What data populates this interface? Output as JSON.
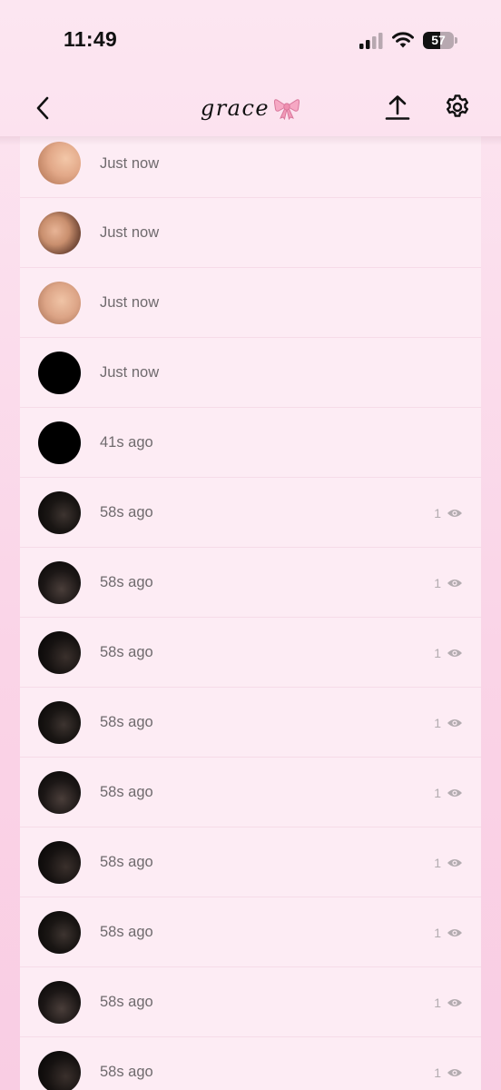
{
  "status_bar": {
    "time": "11:49",
    "battery_percent": "57",
    "battery_level": 0.57,
    "icons": [
      "cellular-signal-icon",
      "wifi-icon",
      "battery-icon"
    ]
  },
  "nav": {
    "title": "grace",
    "title_emoji_icon": "ribbon-bow-icon",
    "left_icon": "chevron-left-icon",
    "right_icons": [
      "upload-icon",
      "gear-icon"
    ]
  },
  "colors": {
    "background": "#fce6f1",
    "list_background": "#fdecf4",
    "timestamp_text": "#6f6a6d",
    "view_count_text": "#b3acb0",
    "bow_pink": "#f29ab8"
  },
  "snaps": [
    {
      "time": "Just now",
      "thumb": "skin-tone-photo",
      "views": ""
    },
    {
      "time": "Just now",
      "thumb": "skin-tone-photo",
      "views": ""
    },
    {
      "time": "Just now",
      "thumb": "skin-tone-photo",
      "views": ""
    },
    {
      "time": "Just now",
      "thumb": "black-photo",
      "views": ""
    },
    {
      "time": "41s ago",
      "thumb": "black-photo",
      "views": ""
    },
    {
      "time": "58s ago",
      "thumb": "dark-photo",
      "views": "1"
    },
    {
      "time": "58s ago",
      "thumb": "dark-photo",
      "views": "1"
    },
    {
      "time": "58s ago",
      "thumb": "dark-photo",
      "views": "1"
    },
    {
      "time": "58s ago",
      "thumb": "dark-photo",
      "views": "1"
    },
    {
      "time": "58s ago",
      "thumb": "dark-photo",
      "views": "1"
    },
    {
      "time": "58s ago",
      "thumb": "dark-photo",
      "views": "1"
    },
    {
      "time": "58s ago",
      "thumb": "dark-photo",
      "views": "1"
    },
    {
      "time": "58s ago",
      "thumb": "dark-photo",
      "views": "1"
    },
    {
      "time": "58s ago",
      "thumb": "dark-photo",
      "views": "1"
    }
  ]
}
